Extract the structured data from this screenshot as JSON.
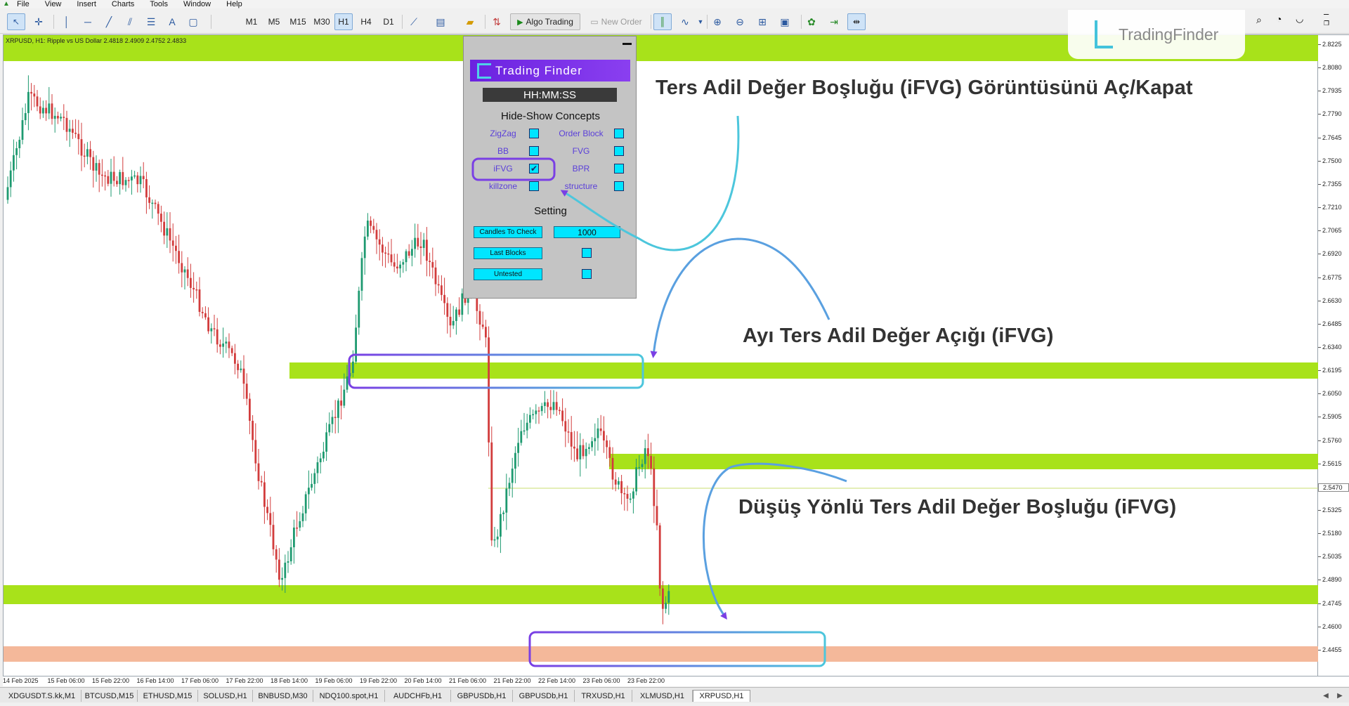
{
  "menu": [
    "File",
    "View",
    "Insert",
    "Charts",
    "Tools",
    "Window",
    "Help"
  ],
  "toolbar": {
    "timeframes": [
      "M1",
      "M5",
      "M15",
      "M30",
      "H1",
      "H4",
      "D1"
    ],
    "active_timeframe": "H1",
    "algo_trading": "Algo Trading",
    "new_order": "New Order"
  },
  "watermark": {
    "text": "TradingFinder"
  },
  "chart": {
    "symbol_info": "XRPUSD, H1:  Ripple vs US Dollar  2.4818 2.4909 2.4752 2.4833",
    "price_labels": [
      "2.8225",
      "2.8080",
      "2.7935",
      "2.7790",
      "2.7645",
      "2.7500",
      "2.7355",
      "2.7210",
      "2.7065",
      "2.6920",
      "2.6775",
      "2.6630",
      "2.6485",
      "2.6340",
      "2.6195",
      "2.6050",
      "2.5905",
      "2.5760",
      "2.5615",
      "2.5470",
      "2.5325",
      "2.5180",
      "2.5035",
      "2.4890",
      "2.4745",
      "2.4600",
      "2.4455"
    ],
    "current_price": "2.5470",
    "time_labels": [
      "14 Feb 2025",
      "15 Feb 06:00",
      "15 Feb 22:00",
      "16 Feb 14:00",
      "17 Feb 06:00",
      "17 Feb 22:00",
      "18 Feb 14:00",
      "19 Feb 06:00",
      "19 Feb 22:00",
      "20 Feb 14:00",
      "21 Feb 06:00",
      "21 Feb 22:00",
      "22 Feb 14:00",
      "23 Feb 06:00",
      "23 Feb 22:00"
    ],
    "colors": {
      "zone_green": "#a8e21a",
      "zone_salmon": "#f4b89a",
      "bull": "#1e9a70",
      "bear": "#d23c3c"
    }
  },
  "panel": {
    "time": "HH:MM:SS",
    "logo": "Trading Finder",
    "hide_show_title": "Hide-Show Concepts",
    "concepts": [
      {
        "label": "ZigZag",
        "checked": false
      },
      {
        "label": "Order Block",
        "checked": false
      },
      {
        "label": "BB",
        "checked": false
      },
      {
        "label": "FVG",
        "checked": false
      },
      {
        "label": "iFVG",
        "checked": true
      },
      {
        "label": "BPR",
        "checked": false
      },
      {
        "label": "killzone",
        "checked": false
      },
      {
        "label": "structure",
        "checked": false
      }
    ],
    "setting_title": "Setting",
    "candles_to_check_label": "Candles To Check",
    "candles_to_check_value": "1000",
    "last_blocks_label": "Last Blocks",
    "untested_label": "Untested",
    "check_mark": "✔"
  },
  "annotations": {
    "toggle": "Ters Adil Değer Boşluğu (iFVG) Görüntüsünü Aç/Kapat",
    "bear_gap": "Ayı Ters Adil Değer Açığı (iFVG)",
    "down_gap": "Düşüş Yönlü Ters Adil Değer Boşluğu (iFVG)"
  },
  "tabs": [
    "XDGUSDT.S.kk,M1",
    "BTCUSD,M15",
    "ETHUSD,M15",
    "SOLUSD,H1",
    "BNBUSD,M30",
    "NDQ100.spot,H1",
    "AUDCHFb,H1",
    "GBPUSDb,H1",
    "GBPUSDb,H1",
    "TRXUSD,H1",
    "XLMUSD,H1",
    "XRPUSD,H1"
  ],
  "active_tab": "XRPUSD,H1",
  "icons": {
    "app": "mt5-app-icon",
    "cursor": "cursor-icon",
    "crosshair": "crosshair-icon",
    "zoom_in": "zoom-in-icon",
    "zoom_out": "zoom-out-icon",
    "minimize": "minimize-icon"
  }
}
